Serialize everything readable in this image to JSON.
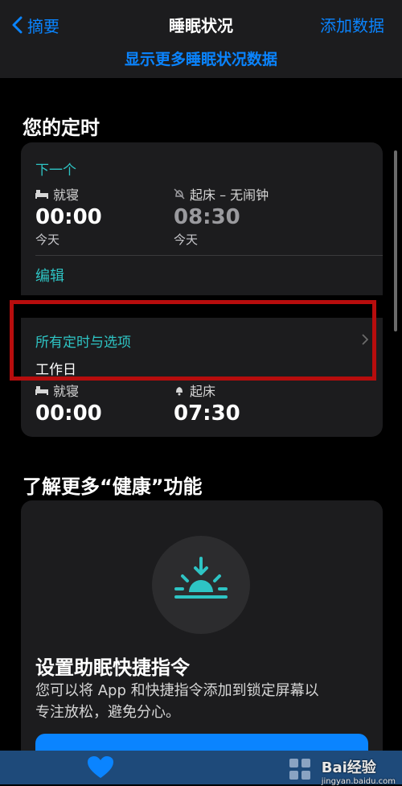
{
  "nav": {
    "back_label": "摘要",
    "title": "睡眠状况",
    "add_label": "添加数据"
  },
  "more_link": "显示更多睡眠状况数据",
  "schedule": {
    "section_title": "您的定时",
    "next": {
      "heading": "下一个",
      "bed_label": "就寝",
      "bed_time": "00:00",
      "bed_day": "今天",
      "wake_label": "起床 – 无闹钟",
      "wake_time": "08:30",
      "wake_day": "今天",
      "edit_label": "编辑"
    },
    "all": {
      "heading": "所有定时与选项",
      "day_group": "工作日",
      "bed_label": "就寝",
      "bed_time": "00:00",
      "wake_label": "起床",
      "wake_time": "07:30"
    }
  },
  "learn": {
    "section_title": "了解更多“健康”功能",
    "card_title": "设置助眠快捷指令",
    "card_body_line1": "您可以将 App 和快捷指令添加到锁定屏幕以",
    "card_body_line2": "专注放松，避免分心。"
  },
  "watermark": {
    "brand": "Bai经验",
    "url": "jingyan.baidu.com"
  },
  "colors": {
    "accent": "#0a84ff",
    "teal": "#2ec4c4",
    "highlight": "#b70d0d"
  }
}
